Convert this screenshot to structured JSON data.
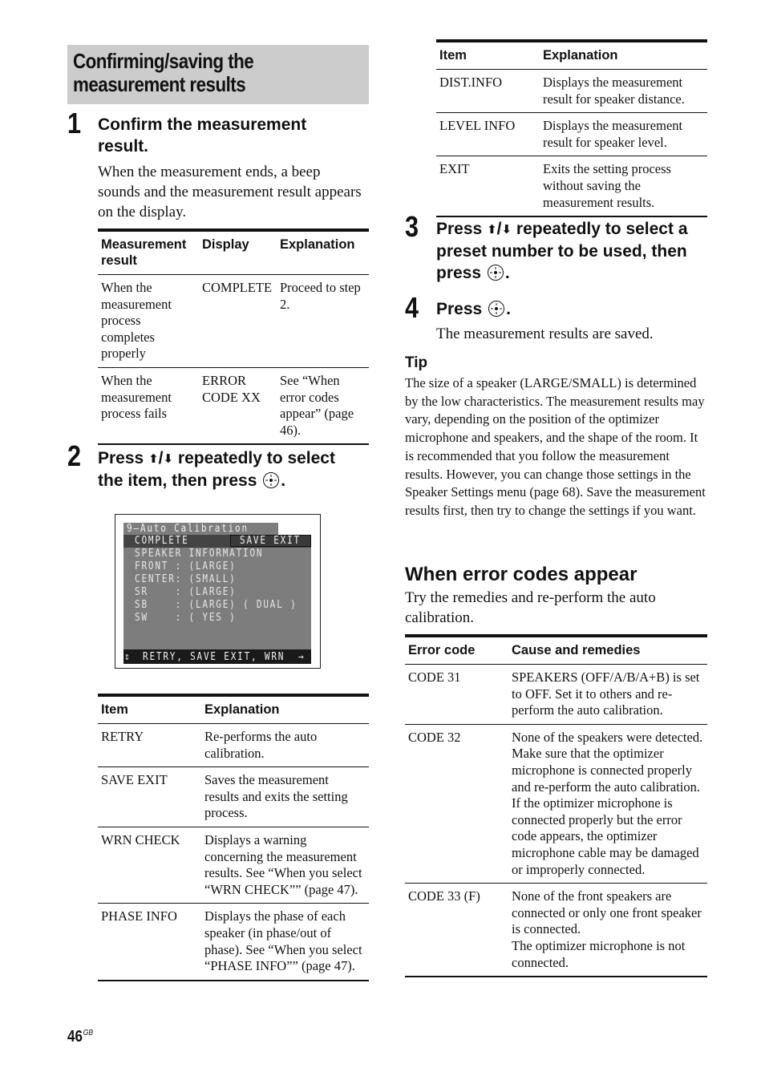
{
  "section": {
    "title": "Confirming/saving the measurement results"
  },
  "steps": [
    {
      "number": "1",
      "heading": "Confirm the measurement result.",
      "body": "When the measurement ends, a beep sounds and the measurement result appears on the display."
    },
    {
      "number": "2",
      "heading_pre": "Press ",
      "arrow_up": "⬆",
      "arrow_sep": "/",
      "arrow_down": "⬇",
      "heading_mid": " repeatedly to select the item, then press ",
      "heading_post": "."
    },
    {
      "number": "3",
      "heading_pre": "Press ",
      "arrow_up": "⬆",
      "arrow_sep": "/",
      "arrow_down": "⬇",
      "heading_mid": " repeatedly to select a preset number to be used, then press ",
      "heading_post": "."
    },
    {
      "number": "4",
      "heading_pre": "Press ",
      "heading_post": ".",
      "body": "The measurement results are saved."
    }
  ],
  "result_table": {
    "headers": [
      "Measurement result",
      "Display",
      "Explanation"
    ],
    "rows": [
      [
        "When the measurement process completes properly",
        "COMPLETE",
        "Proceed to step 2."
      ],
      [
        "When the measurement process fails",
        "ERROR CODE XX",
        "See “When error codes appear” (page 46)."
      ]
    ]
  },
  "osd": {
    "title": "9–Auto Calibration",
    "status": "COMPLETE",
    "selected": "SAVE EXIT",
    "lines": [
      "SPEAKER INFORMATION",
      "FRONT : (LARGE)",
      "CENTER: (SMALL)",
      "SR    : (LARGE)",
      "SB    : (LARGE) ( DUAL )",
      "SW    : ( YES )"
    ],
    "footer_icon": "⇕",
    "footer": "RETRY, SAVE EXIT, WRN",
    "footer_arrow": "→"
  },
  "item_table_left": {
    "headers": [
      "Item",
      "Explanation"
    ],
    "rows": [
      [
        "RETRY",
        "Re-performs the auto calibration."
      ],
      [
        "SAVE EXIT",
        "Saves the measurement results and exits the setting process."
      ],
      [
        "WRN CHECK",
        "Displays a warning concerning the measurement results. See “When you select “WRN CHECK”” (page 47)."
      ],
      [
        "PHASE INFO",
        "Displays the phase of each speaker (in phase/out of phase). See “When you select “PHASE INFO”” (page 47)."
      ]
    ]
  },
  "item_table_right": {
    "headers": [
      "Item",
      "Explanation"
    ],
    "rows": [
      [
        "DIST.INFO",
        "Displays the measurement result for speaker distance."
      ],
      [
        "LEVEL INFO",
        "Displays the measurement result for speaker level."
      ],
      [
        "EXIT",
        "Exits the setting process without saving the measurement results."
      ]
    ]
  },
  "tip": {
    "label": "Tip",
    "body": "The size of a speaker (LARGE/SMALL) is determined by the low characteristics. The measurement results may vary, depending on the position of the optimizer microphone and speakers, and the shape of the room. It is recommended that you follow the measurement results. However, you can change those settings in the Speaker Settings menu (page 68). Save the measurement results first, then try to change the settings if you want."
  },
  "errors": {
    "heading": "When error codes appear",
    "intro": "Try the remedies and re-perform the auto calibration.",
    "headers": [
      "Error code",
      "Cause and remedies"
    ],
    "rows": [
      [
        "CODE 31",
        "SPEAKERS (OFF/A/B/A+B) is set to OFF. Set it to others and re-perform the auto calibration."
      ],
      [
        "CODE 32",
        "None of the speakers were detected. Make sure that the optimizer microphone is connected properly and re-perform the auto calibration.\nIf the optimizer microphone is connected properly but the error code appears, the optimizer microphone cable may be damaged or improperly connected."
      ],
      [
        "CODE 33 (F)",
        "None of the front speakers are connected or only one front speaker is connected.\nThe optimizer microphone is not connected."
      ]
    ]
  },
  "footer": {
    "page_number": "46",
    "region": "GB"
  }
}
